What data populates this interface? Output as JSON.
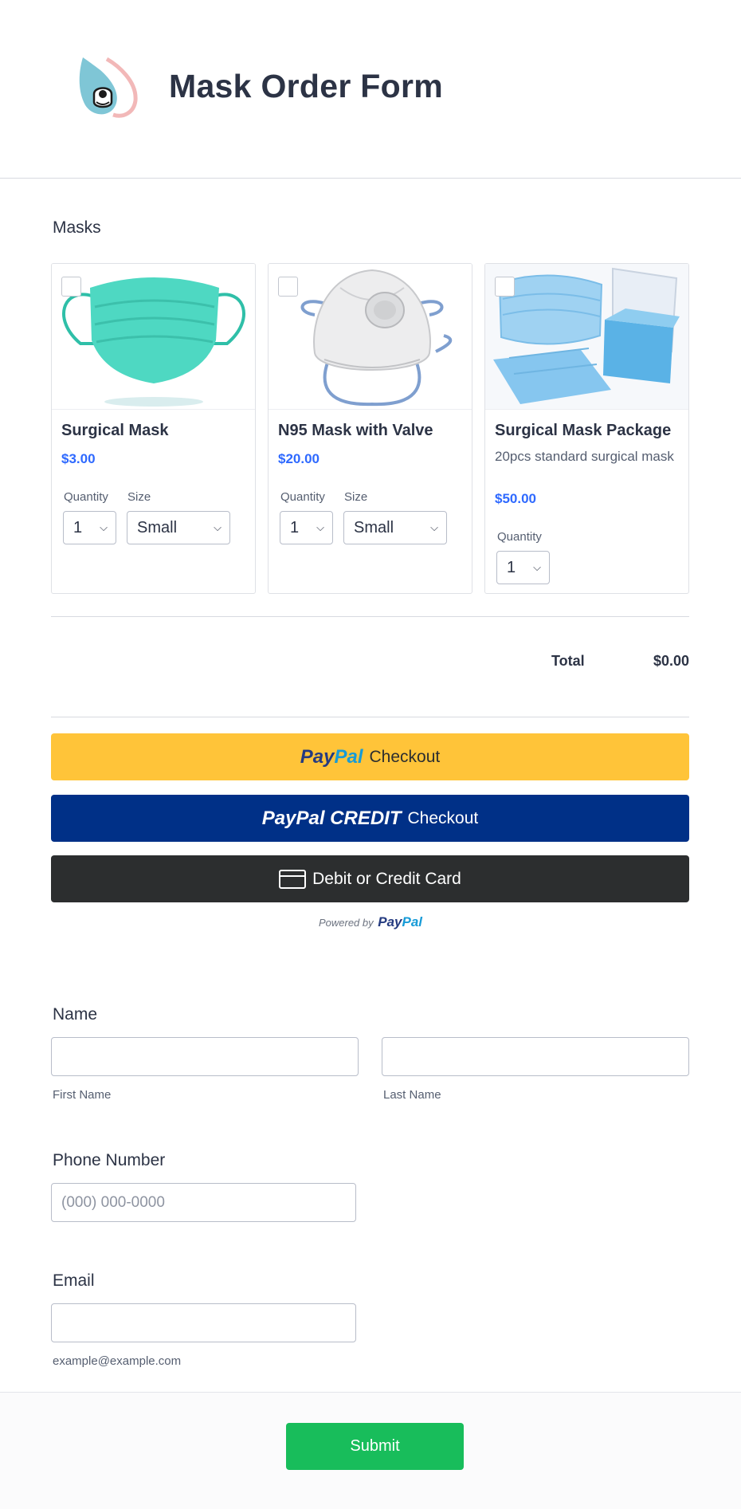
{
  "form": {
    "title": "Mask Order Form"
  },
  "masks": {
    "label": "Masks",
    "products": [
      {
        "name": "Surgical Mask",
        "price": "$3.00",
        "description": "",
        "quantity_label": "Quantity",
        "quantity": "1",
        "size_label": "Size",
        "size": "Small"
      },
      {
        "name": "N95 Mask with Valve",
        "price": "$20.00",
        "description": "",
        "quantity_label": "Quantity",
        "quantity": "1",
        "size_label": "Size",
        "size": "Small"
      },
      {
        "name": "Surgical Mask Package",
        "price": "$50.00",
        "description": "20pcs standard surgical mask",
        "quantity_label": "Quantity",
        "quantity": "1"
      }
    ]
  },
  "total": {
    "label": "Total",
    "value": "$0.00"
  },
  "payment": {
    "paypal": {
      "logo_pay": "Pay",
      "logo_pal": "Pal",
      "label": "Checkout"
    },
    "paypal_credit": {
      "logo": "PayPal CREDIT",
      "label": "Checkout"
    },
    "card": {
      "label": "Debit or Credit Card"
    },
    "powered_by": {
      "prefix": "Powered by",
      "logo_pay": "Pay",
      "logo_pal": "Pal"
    }
  },
  "name": {
    "label": "Name",
    "first_sublabel": "First Name",
    "last_sublabel": "Last Name",
    "first_value": "",
    "last_value": ""
  },
  "phone": {
    "label": "Phone Number",
    "placeholder": "(000) 000-0000"
  },
  "email": {
    "label": "Email",
    "sublabel": "example@example.com",
    "value": ""
  },
  "submit": {
    "label": "Submit"
  },
  "colors": {
    "price": "#2e69ff",
    "paypal_yellow": "#ffc439",
    "paypal_blue": "#003087",
    "card_dark": "#2c2e2f",
    "submit_green": "#18bd5b"
  }
}
